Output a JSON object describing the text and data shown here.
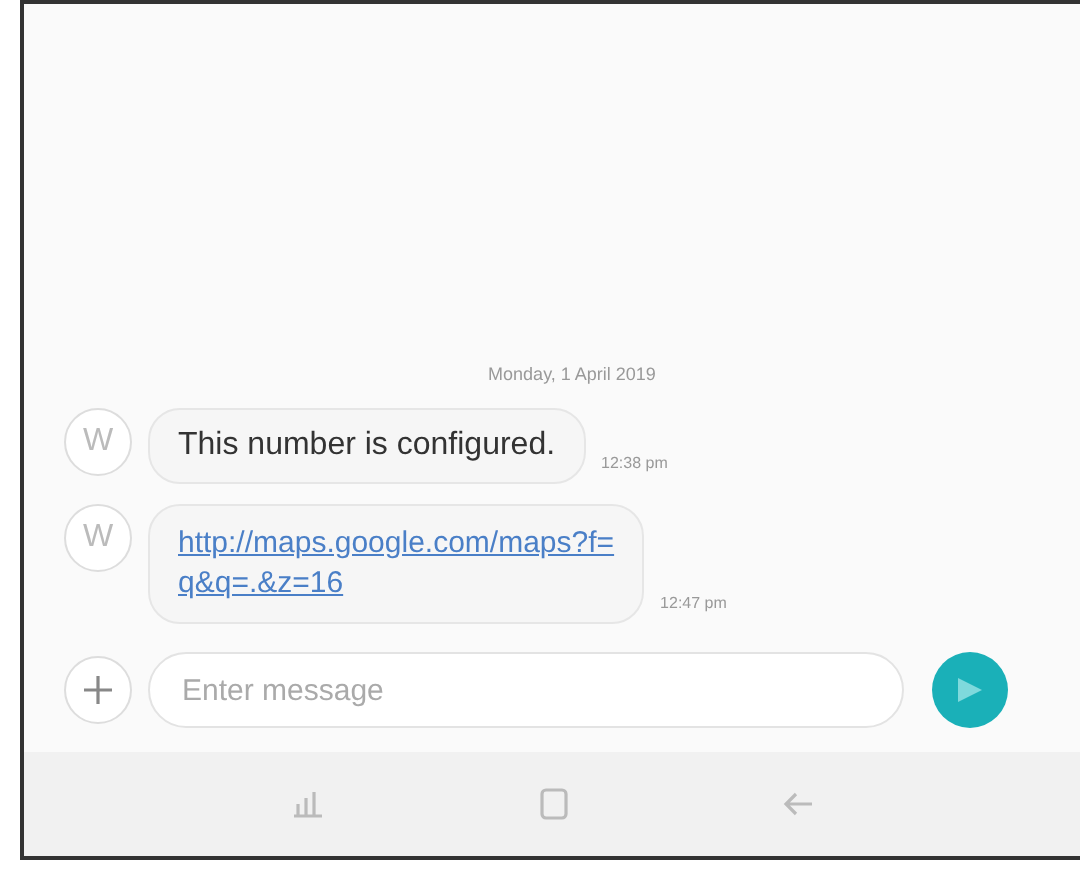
{
  "date_header": "Monday, 1 April 2019",
  "messages": [
    {
      "avatar": "W",
      "kind": "text",
      "text": "This number is configured.",
      "time": "12:38 pm"
    },
    {
      "avatar": "W",
      "kind": "link",
      "text": "http://maps.google.com/maps?f=\nq&q=.&z=16",
      "time": "12:47 pm"
    }
  ],
  "composer": {
    "placeholder": "Enter message"
  }
}
